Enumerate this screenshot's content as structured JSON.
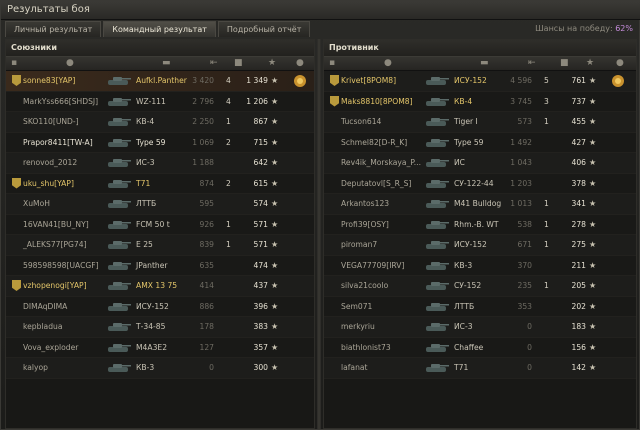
{
  "window": {
    "title": "Результаты боя"
  },
  "tabs": [
    {
      "label": "Личный результат",
      "active": false
    },
    {
      "label": "Командный результат",
      "active": true
    },
    {
      "label": "Подробный отчёт",
      "active": false
    }
  ],
  "win_chance": {
    "label": "Шансы на победу:",
    "value": "62%"
  },
  "allies": {
    "title": "Союзники",
    "rows": [
      {
        "player": "sonne83[YAP]",
        "vehicle": "Aufkl.Panther",
        "dmg": "3 420",
        "kills": "4",
        "xp": "1 349",
        "platoon": true,
        "self": true,
        "medal": true
      },
      {
        "player": "MarkYss666[SHDSJ]",
        "vehicle": "WZ-111",
        "dmg": "2 796",
        "kills": "4",
        "xp": "1 206"
      },
      {
        "player": "SKO110[UND-]",
        "vehicle": "КВ-4",
        "dmg": "2 250",
        "kills": "1",
        "xp": "867"
      },
      {
        "player": "Prapor8411[TW-A]",
        "vehicle": "Type 59",
        "dmg": "1 069",
        "kills": "2",
        "xp": "715",
        "bright": true
      },
      {
        "player": "renovod_2012",
        "vehicle": "ИС-3",
        "dmg": "1 188",
        "kills": "",
        "xp": "642"
      },
      {
        "player": "uku_shu[YAP]",
        "vehicle": "T71",
        "dmg": "874",
        "kills": "2",
        "xp": "615",
        "platoon": true
      },
      {
        "player": "XuMoH",
        "vehicle": "ЛТТБ",
        "dmg": "595",
        "kills": "",
        "xp": "574"
      },
      {
        "player": "16VAN41[BU_NY]",
        "vehicle": "FCM 50 t",
        "dmg": "926",
        "kills": "1",
        "xp": "571"
      },
      {
        "player": "_ALEKS77[PG74]",
        "vehicle": "E 25",
        "dmg": "839",
        "kills": "1",
        "xp": "571"
      },
      {
        "player": "598598598[UACGF]",
        "vehicle": "JPanther",
        "dmg": "635",
        "kills": "",
        "xp": "474"
      },
      {
        "player": "vzhopenogi[YAP]",
        "vehicle": "AMX 13 75",
        "dmg": "414",
        "kills": "",
        "xp": "437",
        "platoon": true
      },
      {
        "player": "DIMAqDIMA",
        "vehicle": "ИСУ-152",
        "dmg": "886",
        "kills": "",
        "xp": "396"
      },
      {
        "player": "kepbladua",
        "vehicle": "Т-34-85",
        "dmg": "178",
        "kills": "",
        "xp": "383"
      },
      {
        "player": "Vova_exploder",
        "vehicle": "M4A3E2",
        "dmg": "127",
        "kills": "",
        "xp": "357"
      },
      {
        "player": "kalyop",
        "vehicle": "КВ-3",
        "dmg": "0",
        "kills": "",
        "xp": "300"
      }
    ]
  },
  "enemies": {
    "title": "Противник",
    "rows": [
      {
        "player": "Krivet[8POM8]",
        "vehicle": "ИСУ-152",
        "dmg": "4 596",
        "kills": "5",
        "xp": "761",
        "platoon": true,
        "medal": true
      },
      {
        "player": "Maks8810[8POM8]",
        "vehicle": "КВ-4",
        "dmg": "3 745",
        "kills": "3",
        "xp": "737",
        "platoon": true
      },
      {
        "player": "Tucson614",
        "vehicle": "Tiger I",
        "dmg": "573",
        "kills": "1",
        "xp": "455"
      },
      {
        "player": "Schmel82[D-R_K]",
        "vehicle": "Type 59",
        "dmg": "1 492",
        "kills": "",
        "xp": "427"
      },
      {
        "player": "Rev4ik_Morskaya_P...",
        "vehicle": "ИС",
        "dmg": "1 043",
        "kills": "",
        "xp": "406"
      },
      {
        "player": "Deputatovl[S_R_S]",
        "vehicle": "СУ-122-44",
        "dmg": "1 203",
        "kills": "",
        "xp": "378"
      },
      {
        "player": "Arkantos123",
        "vehicle": "M41 Bulldog",
        "dmg": "1 013",
        "kills": "1",
        "xp": "341"
      },
      {
        "player": "Profi39[OSY]",
        "vehicle": "Rhm.-B. WT",
        "dmg": "538",
        "kills": "1",
        "xp": "278"
      },
      {
        "player": "piroman7",
        "vehicle": "ИСУ-152",
        "dmg": "671",
        "kills": "1",
        "xp": "275"
      },
      {
        "player": "VEGA77709[IRV]",
        "vehicle": "КВ-3",
        "dmg": "370",
        "kills": "",
        "xp": "211"
      },
      {
        "player": "silva21coolo",
        "vehicle": "СУ-152",
        "dmg": "235",
        "kills": "1",
        "xp": "205"
      },
      {
        "player": "Sem071",
        "vehicle": "ЛТТБ",
        "dmg": "353",
        "kills": "",
        "xp": "202"
      },
      {
        "player": "merkyriu",
        "vehicle": "ИС-3",
        "dmg": "0",
        "kills": "",
        "xp": "183"
      },
      {
        "player": "biathlonist73",
        "vehicle": "Chaffee",
        "dmg": "0",
        "kills": "",
        "xp": "156"
      },
      {
        "player": "lafanat",
        "vehicle": "T71",
        "dmg": "0",
        "kills": "",
        "xp": "142"
      }
    ]
  },
  "colors": {
    "platoon": "#e4c66a",
    "win_chance": "#c38bd8",
    "self_row": "#3a2a1c"
  },
  "icons": {
    "column": [
      "platoon-icon",
      "player-icon",
      "vehicle-icon",
      "damage-icon",
      "kills-icon",
      "xp-star-icon",
      "medal-icon"
    ]
  }
}
